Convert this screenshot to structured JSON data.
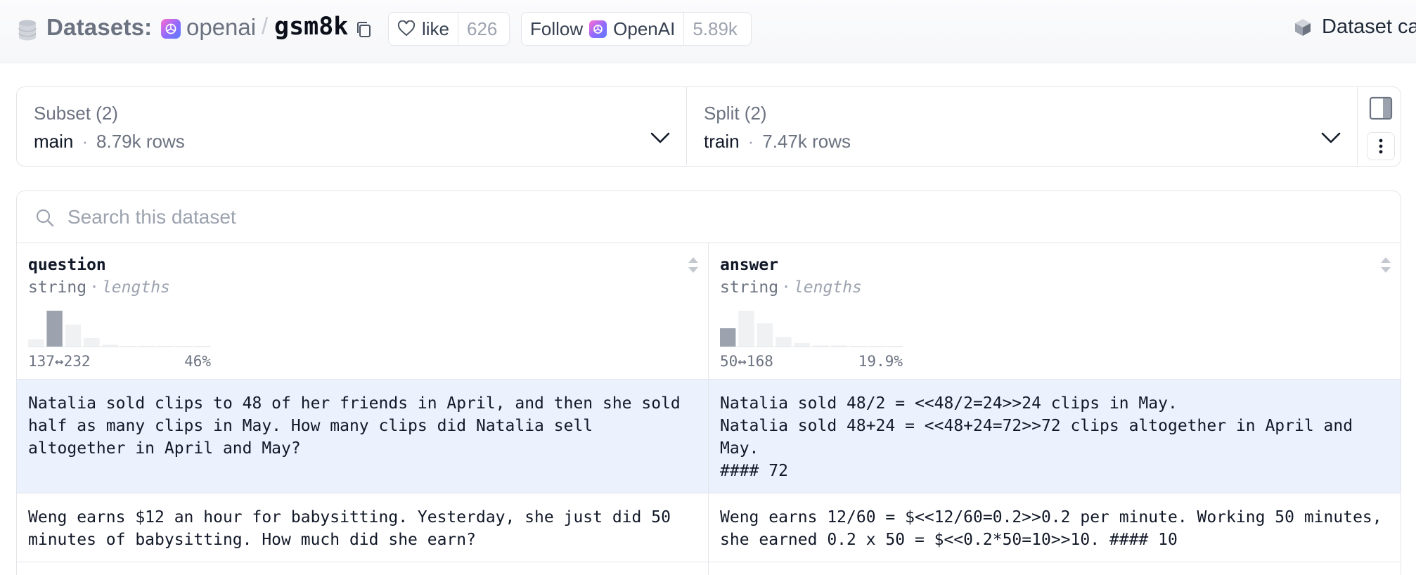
{
  "header": {
    "datasets_label": "Datasets:",
    "org": "openai",
    "separator": "/",
    "repo": "gsm8k",
    "like_label": "like",
    "like_count": "626",
    "follow_label": "Follow",
    "follow_org": "OpenAI",
    "follow_count": "5.89k",
    "dataset_card_label": "Dataset ca"
  },
  "selectors": {
    "subset": {
      "title": "Subset (2)",
      "value": "main",
      "dot": "·",
      "rows": "8.79k rows"
    },
    "split": {
      "title": "Split (2)",
      "value": "train",
      "dot": "·",
      "rows": "7.47k rows"
    }
  },
  "search": {
    "placeholder": "Search this dataset"
  },
  "columns": [
    {
      "name": "question",
      "type": "string",
      "sep": "·",
      "stat": "lengths",
      "range": "137↔232",
      "percent": "46%",
      "histogram": [
        0.22,
        1.0,
        0.62,
        0.25,
        0.07,
        0.04,
        0.04,
        0.04,
        0.04,
        0.04
      ],
      "highlight_bin": 1
    },
    {
      "name": "answer",
      "type": "string",
      "sep": "·",
      "stat": "lengths",
      "range": "50↔168",
      "percent": "19.9%",
      "histogram": [
        0.52,
        1.0,
        0.66,
        0.28,
        0.12,
        0.05,
        0.05,
        0.04,
        0.04,
        0.04
      ],
      "highlight_bin": 0
    }
  ],
  "rows": [
    {
      "question": "Natalia sold clips to 48 of her friends in April, and then she sold half as many clips in May. How many clips did Natalia sell altogether in April and May?",
      "answer": "Natalia sold 48/2 = <<48/2=24>>24 clips in May.\nNatalia sold 48+24 = <<48+24=72>>72 clips altogether in April and May.\n#### 72"
    },
    {
      "question": "Weng earns $12 an hour for babysitting. Yesterday, she just did 50 minutes of babysitting. How much did she earn?",
      "answer": "Weng earns 12/60 = $<<12/60=0.2>>0.2 per minute. Working 50 minutes, she earned 0.2 x 50 = $<<0.2*50=10>>10. #### 10"
    }
  ],
  "colors": {
    "selected_row": "#ebf2fd",
    "hist_highlight": "#9ca3af",
    "hist_bar": "#f0f1f3"
  }
}
